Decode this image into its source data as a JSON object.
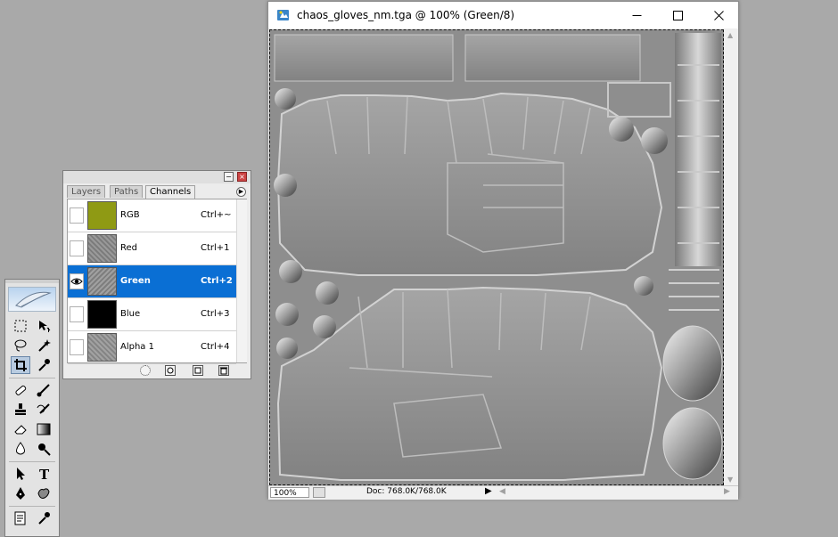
{
  "document": {
    "title": "chaos_gloves_nm.tga @ 100% (Green/8)",
    "zoom": "100%",
    "doc_info": "Doc: 768.0K/768.0K"
  },
  "channels_palette": {
    "tabs": [
      {
        "label": "Layers",
        "active": false
      },
      {
        "label": "Paths",
        "active": false
      },
      {
        "label": "Channels",
        "active": true
      }
    ],
    "channels": [
      {
        "name": "RGB",
        "shortcut": "Ctrl+~",
        "visible": false,
        "selected": false,
        "thumb": "#8f9a14"
      },
      {
        "name": "Red",
        "shortcut": "Ctrl+1",
        "visible": false,
        "selected": false,
        "thumb": "#8a8a8a"
      },
      {
        "name": "Green",
        "shortcut": "Ctrl+2",
        "visible": true,
        "selected": true,
        "thumb": "#8a8a8a"
      },
      {
        "name": "Blue",
        "shortcut": "Ctrl+3",
        "visible": false,
        "selected": false,
        "thumb": "#000000"
      },
      {
        "name": "Alpha 1",
        "shortcut": "Ctrl+4",
        "visible": false,
        "selected": false,
        "thumb": "#8a8a8a"
      }
    ]
  },
  "toolbox": {
    "tools": [
      "marquee-tool-icon",
      "move-tool-icon",
      "lasso-tool-icon",
      "magic-wand-tool-icon",
      "crop-tool-icon",
      "eyedropper-tool-icon",
      "healing-brush-tool-icon",
      "brush-tool-icon",
      "clone-stamp-tool-icon",
      "history-brush-tool-icon",
      "eraser-tool-icon",
      "gradient-tool-icon",
      "blur-tool-icon",
      "dodge-tool-icon",
      "path-selection-tool-icon",
      "type-tool-icon",
      "pen-tool-icon",
      "custom-shape-tool-icon",
      "notes-tool-icon",
      "eyedropper-tool-icon"
    ],
    "selected_tool": "crop-tool-icon"
  },
  "colors": {
    "selection_blue": "#0a6fd4",
    "workspace_gray": "#a9a9a9",
    "canvas_gray": "#8f8f8f"
  }
}
